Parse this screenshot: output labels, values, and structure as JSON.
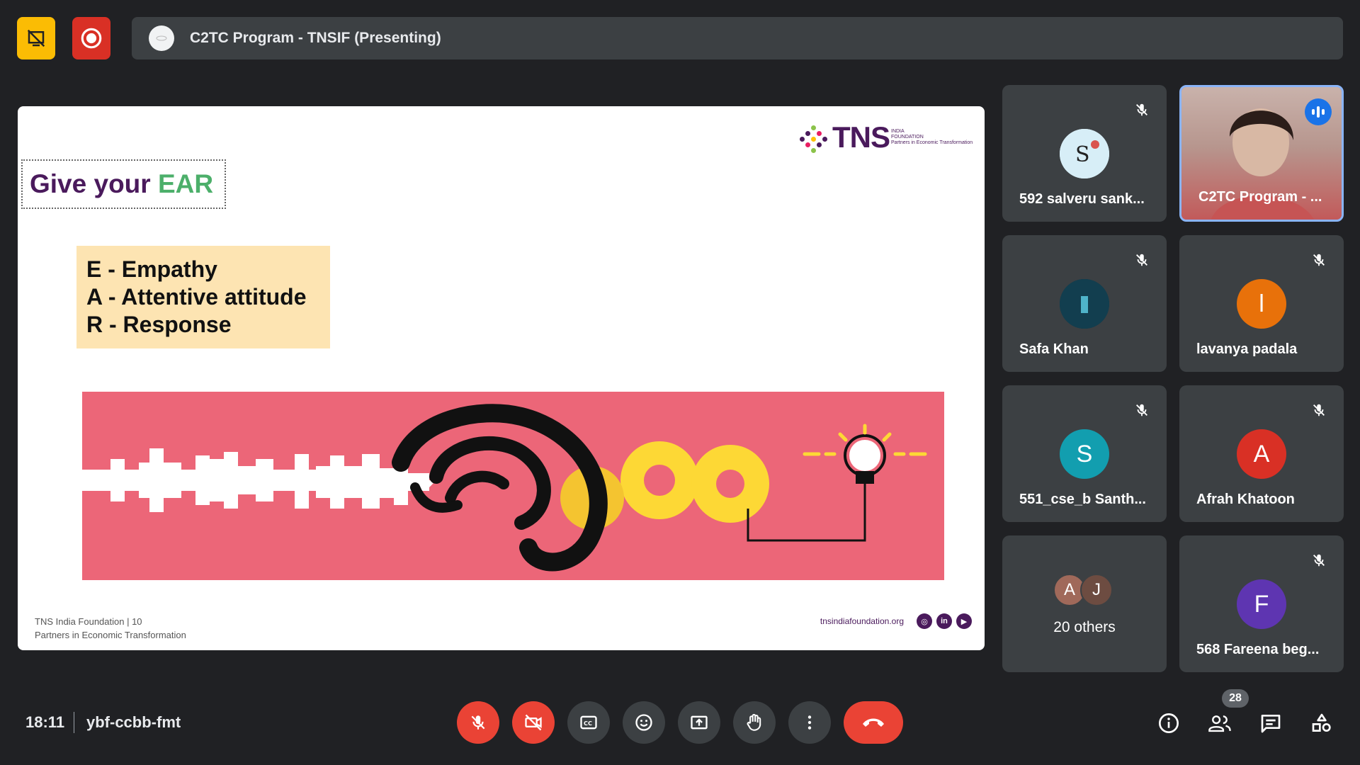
{
  "header": {
    "title": "C2TC Program - TNSIF (Presenting)",
    "left_buttons": [
      {
        "icon": "presentation-off-icon",
        "color": "#fbbc04"
      },
      {
        "icon": "record-icon",
        "color": "#d93025"
      }
    ]
  },
  "slide": {
    "logo_text": "TNS",
    "logo_sub1": "INDIA",
    "logo_sub2": "FOUNDATION",
    "logo_tagline": "Partners in Economic Transformation",
    "title_part1": "Give your ",
    "title_part2": "EAR",
    "ear_lines": [
      "E - Empathy",
      "A - Attentive attitude",
      "R - Response"
    ],
    "footer_line1": "TNS India Foundation | 10",
    "footer_line2": "Partners in Economic Transformation",
    "footer_url": "tnsindiafoundation.org",
    "colors": {
      "purple": "#4a1a5c",
      "green": "#4caf6a",
      "banner": "#ec6678",
      "box": "#fde4b2"
    }
  },
  "participants": [
    {
      "name": "592 salveru sank...",
      "avatar": "image",
      "muted": true
    },
    {
      "name": "C2TC Program - ...",
      "avatar": "video",
      "muted": false,
      "speaking": true
    },
    {
      "name": "Safa Khan",
      "avatar": "image",
      "muted": true
    },
    {
      "name": "lavanya padala",
      "avatar": "l",
      "color": "#e8710a",
      "muted": true
    },
    {
      "name": "551_cse_b Santh...",
      "avatar": "S",
      "color": "#129eaf",
      "muted": true
    },
    {
      "name": "Afrah Khatoon",
      "avatar": "A",
      "color": "#d93025",
      "muted": true
    },
    {
      "name": "568 Fareena beg...",
      "avatar": "F",
      "color": "#5e35b1",
      "muted": true
    }
  ],
  "others": {
    "label": "20 others",
    "avatars": [
      {
        "letter": "A",
        "color": "#a0695a"
      },
      {
        "letter": "J",
        "color": "#6d4c41"
      }
    ]
  },
  "bottom": {
    "time": "18:11",
    "meeting_code": "ybf-ccbb-fmt",
    "people_count": "28"
  }
}
